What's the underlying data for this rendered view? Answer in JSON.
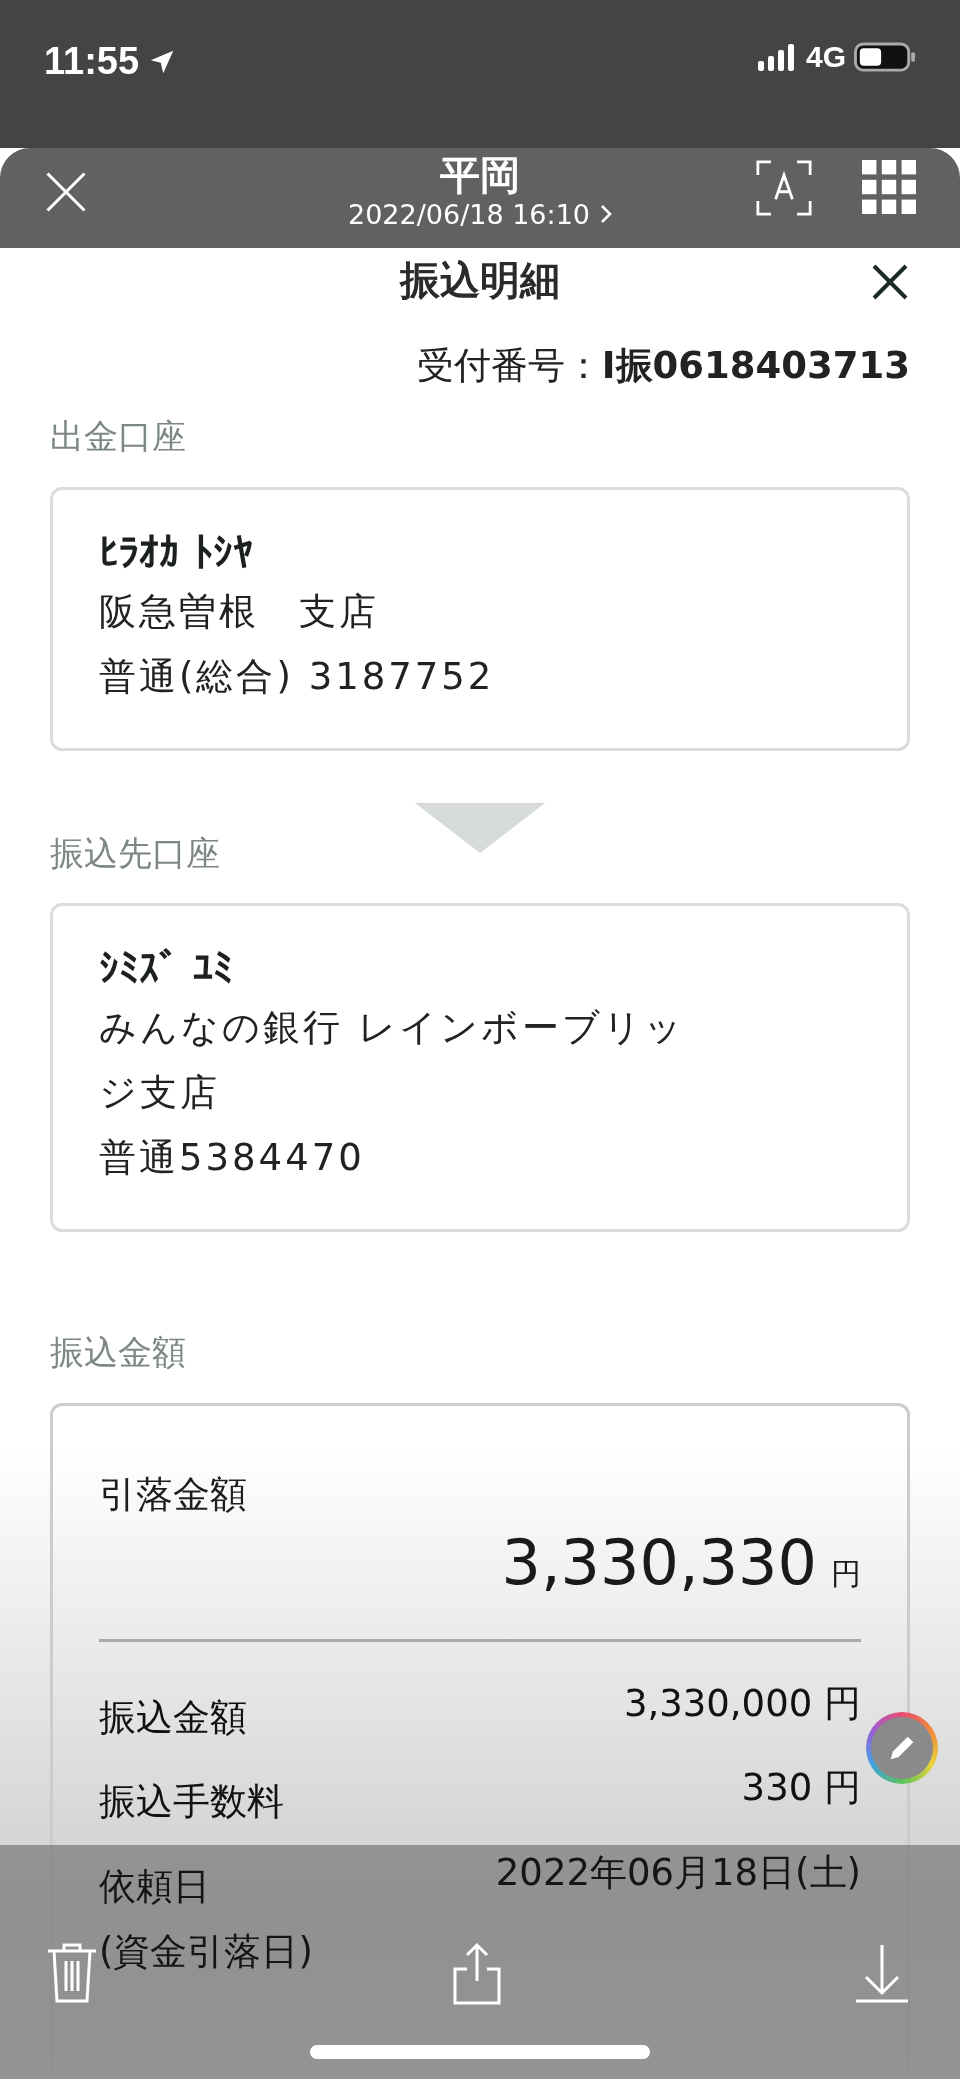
{
  "status_bar": {
    "time": "11:55",
    "network": "4G"
  },
  "viewer_header": {
    "title": "平岡",
    "subtitle": "2022/06/18 16:10"
  },
  "document": {
    "title": "振込明細",
    "reception": "受付番号：**I振0618403713**",
    "sections": [
      {
        "kind": "account",
        "heading": "出金口座",
        "name": "ﾋﾗｵｶ ﾄｼﾔ",
        "lines": [
          "阪急曽根　支店",
          "普通(総合) 3187752"
        ]
      },
      {
        "kind": "account",
        "heading": "振込先口座",
        "name": "ｼﾐｽﾞ ﾕﾐ",
        "lines": [
          "みんなの銀行 レインボーブリッジ支店",
          "普通5384470"
        ]
      },
      {
        "kind": "amount",
        "heading": "振込金額",
        "total": {
          "label": "引落金額",
          "amount": "3,330,330",
          "unit": "円"
        },
        "rows": [
          {
            "label": "振込金額",
            "value": "3,330,000 円"
          },
          {
            "label": "振込手数料",
            "value": "330 円"
          },
          {
            "label": "依頼日\n(資金引落日)",
            "value": "2022年06月18日(土)"
          }
        ]
      }
    ]
  }
}
